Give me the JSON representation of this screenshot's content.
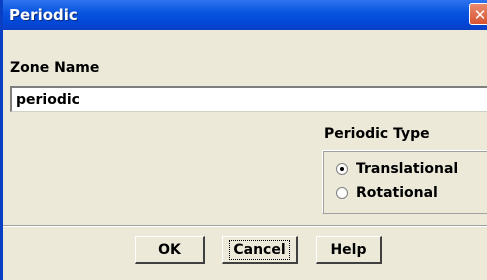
{
  "window": {
    "title": "Periodic",
    "close_glyph": "✕"
  },
  "zone": {
    "label": "Zone Name",
    "value": "periodic"
  },
  "periodic_type": {
    "label": "Periodic Type",
    "options": [
      {
        "label": "Translational",
        "selected": true
      },
      {
        "label": "Rotational",
        "selected": false
      }
    ]
  },
  "buttons": {
    "ok": "OK",
    "cancel": "Cancel",
    "help": "Help"
  },
  "colors": {
    "titlebar": "#0a56e0",
    "dialog_bg": "#ece9d8",
    "close_button": "#d9532f"
  }
}
